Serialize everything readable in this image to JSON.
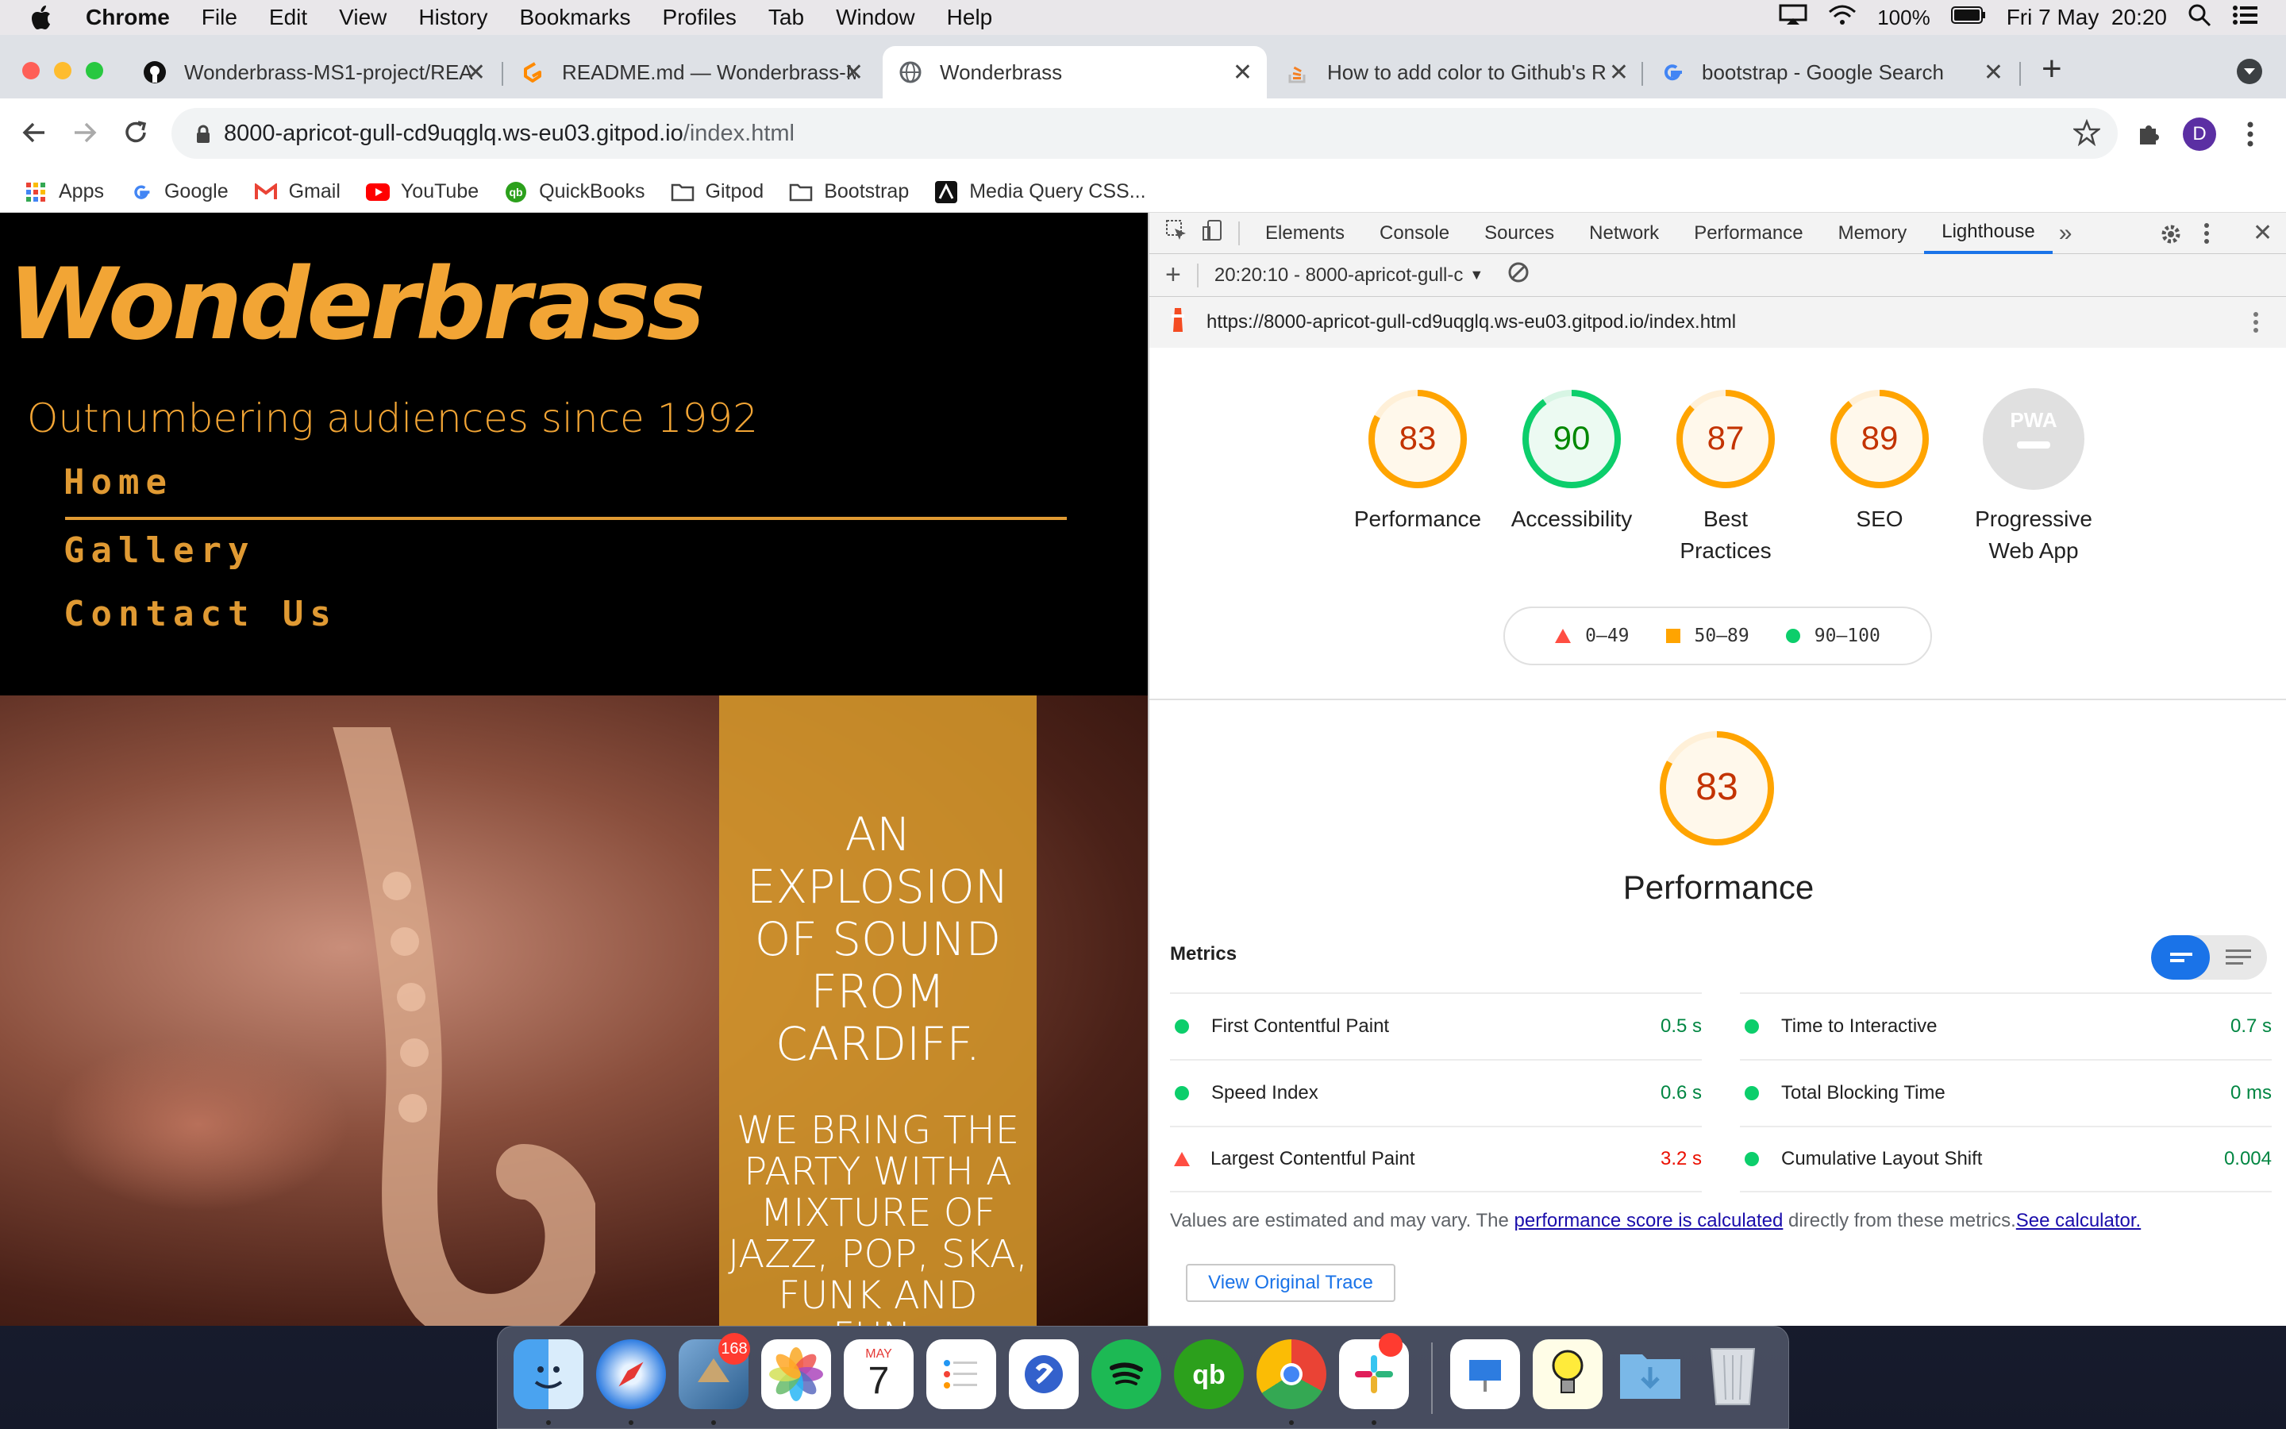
{
  "menubar": {
    "app": "Chrome",
    "items": [
      "File",
      "Edit",
      "View",
      "History",
      "Bookmarks",
      "Profiles",
      "Tab",
      "Window",
      "Help"
    ],
    "battery": "100%",
    "datetime": "Fri 7 May  20:20"
  },
  "tabs": [
    {
      "title": "Wonderbrass-MS1-project/REA",
      "icon": "github-icon"
    },
    {
      "title": "README.md — Wonderbrass-M",
      "icon": "gitpod-icon"
    },
    {
      "title": "Wonderbrass",
      "icon": "globe-icon",
      "active": true
    },
    {
      "title": "How to add color to Github's R",
      "icon": "stackoverflow-icon"
    },
    {
      "title": "bootstrap - Google Search",
      "icon": "google-icon"
    }
  ],
  "address": {
    "host": "8000-apricot-gull-cd9uqglq.ws-eu03.gitpod.io",
    "path": "/index.html"
  },
  "profile_initial": "D",
  "bookmarks": [
    "Apps",
    "Google",
    "Gmail",
    "YouTube",
    "QuickBooks",
    "Gitpod",
    "Bootstrap",
    "Media Query CSS..."
  ],
  "site": {
    "logo": "Wonderbrass",
    "tagline": "Outnumbering audiences since 1992",
    "nav": [
      "Home",
      "Gallery",
      "Contact Us"
    ],
    "hero_heading": "AN EXPLOSION OF SOUND FROM CARDIFF.",
    "hero_text": "WE BRING THE PARTY WITH A MIXTURE OF JAZZ, POP, SKA, FUNK AND FUN."
  },
  "devtools": {
    "tabs": [
      "Elements",
      "Console",
      "Sources",
      "Network",
      "Performance",
      "Memory",
      "Lighthouse"
    ],
    "active_tab": "Lighthouse",
    "report_select": "20:20:10 - 8000-apricot-gull-c",
    "report_url": "https://8000-apricot-gull-cd9uqglq.ws-eu03.gitpod.io/index.html",
    "scores": [
      {
        "label": "Performance",
        "score": 83,
        "color": "#ffa400"
      },
      {
        "label": "Accessibility",
        "score": 90,
        "color": "#0cce6b"
      },
      {
        "label": "Best Practices",
        "score": 87,
        "color": "#ffa400"
      },
      {
        "label": "SEO",
        "score": 89,
        "color": "#ffa400"
      },
      {
        "label": "Progressive Web App",
        "score": null,
        "badge": "PWA"
      }
    ],
    "legend": [
      "0–49",
      "50–89",
      "90–100"
    ],
    "main_score": 83,
    "main_title": "Performance",
    "metrics_label": "Metrics",
    "metrics_left": [
      {
        "name": "First Contentful Paint",
        "value": "0.5 s",
        "status": "pass"
      },
      {
        "name": "Speed Index",
        "value": "0.6 s",
        "status": "pass"
      },
      {
        "name": "Largest Contentful Paint",
        "value": "3.2 s",
        "status": "fail"
      }
    ],
    "metrics_right": [
      {
        "name": "Time to Interactive",
        "value": "0.7 s",
        "status": "pass"
      },
      {
        "name": "Total Blocking Time",
        "value": "0 ms",
        "status": "pass"
      },
      {
        "name": "Cumulative Layout Shift",
        "value": "0.004",
        "status": "pass"
      }
    ],
    "note_prefix": "Values are estimated and may vary. The ",
    "note_link1": "performance score is calculated",
    "note_mid": " directly from these metrics.",
    "note_link2": "See calculator.",
    "trace_button": "View Original Trace"
  },
  "dock": {
    "mail_badge": "168",
    "calendar_month": "MAY",
    "calendar_day": "7"
  },
  "colors": {
    "brand_orange": "#f2a535",
    "lh_pass": "#0cce6b",
    "lh_average": "#ffa400",
    "lh_fail": "#ff4e42",
    "accent_blue": "#1a73e8"
  }
}
